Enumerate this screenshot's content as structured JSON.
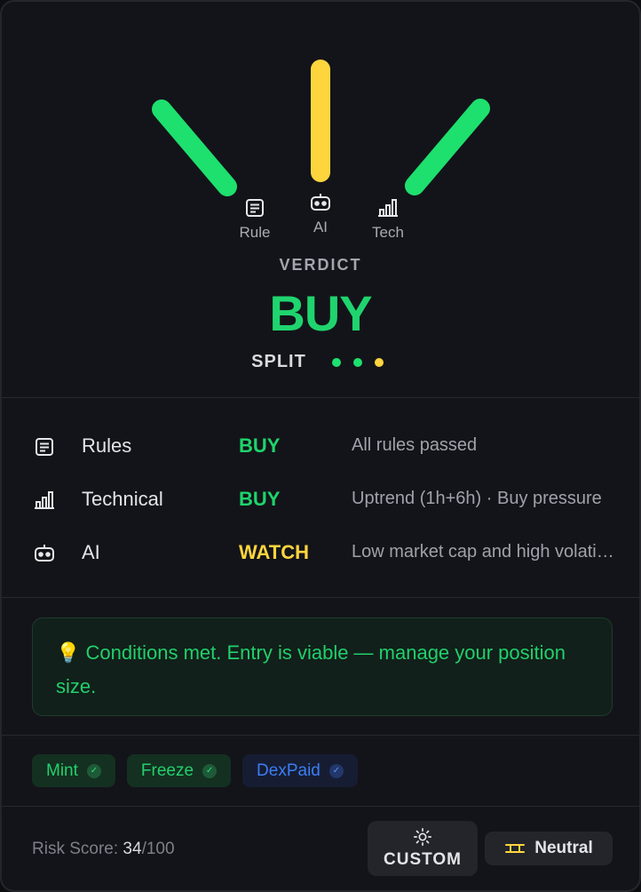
{
  "gauge": {
    "labels": {
      "rule": "Rule",
      "ai": "AI",
      "tech": "Tech"
    },
    "colors": {
      "rule": "#1ee06e",
      "ai": "#ffd53e",
      "tech": "#1ee06e"
    }
  },
  "verdict": {
    "caption": "VERDICT",
    "value": "BUY",
    "split_label": "SPLIT",
    "dots": [
      "#1ee06e",
      "#1ee06e",
      "#ffd53e"
    ]
  },
  "rows": [
    {
      "icon": "document-icon",
      "name": "Rules",
      "verdict": "BUY",
      "verdict_color": "#1ed46c",
      "detail": "All rules passed"
    },
    {
      "icon": "bar-chart-icon",
      "name": "Technical",
      "verdict": "BUY",
      "verdict_color": "#1ed46c",
      "detail": "Uptrend (1h+6h) · Buy pressure"
    },
    {
      "icon": "robot-icon",
      "name": "AI",
      "verdict": "WATCH",
      "verdict_color": "#ffd53e",
      "detail": "Low market cap and high volatility"
    }
  ],
  "tip": {
    "icon": "💡",
    "text": "Conditions met. Entry is viable — manage your position size."
  },
  "tags": [
    {
      "label": "Mint",
      "style": "green"
    },
    {
      "label": "Freeze",
      "style": "green"
    },
    {
      "label": "DexPaid",
      "style": "blue"
    }
  ],
  "footer": {
    "risk_label": "Risk Score: ",
    "risk_value": "34",
    "risk_max": "/100",
    "custom_label": "CUSTOM",
    "neutral_label": "Neutral"
  }
}
